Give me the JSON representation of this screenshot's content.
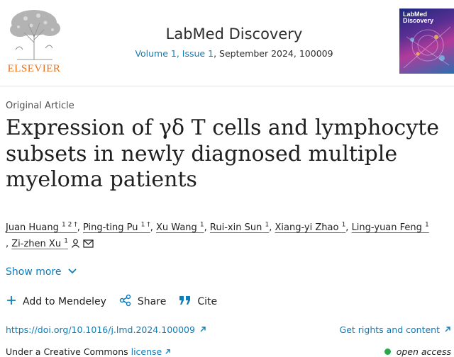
{
  "header": {
    "publisher_name": "ELSEVIER",
    "journal_title": "LabMed Discovery",
    "volume_issue": "Volume 1, Issue 1",
    "date_id": ", September 2024, 100009",
    "cover_title_line1": "LabMed",
    "cover_title_line2": "Discovery"
  },
  "article": {
    "type": "Original Article",
    "title": "Expression of γδ T cells and lymphocyte subsets in newly diagnosed multiple myeloma patients",
    "authors": [
      {
        "name": "Juan Huang",
        "sup": "1 2 †"
      },
      {
        "name": "Ping-ting Pu",
        "sup": "1 †"
      },
      {
        "name": "Xu Wang",
        "sup": "1"
      },
      {
        "name": "Rui-xin Sun",
        "sup": "1"
      },
      {
        "name": "Xiang-yi Zhao",
        "sup": "1"
      },
      {
        "name": "Ling-yuan Feng",
        "sup": "1"
      },
      {
        "name": "Zi-zhen Xu",
        "sup": "1"
      }
    ],
    "separator": ", ",
    "show_more": "Show more"
  },
  "actions": {
    "mendeley": "Add to Mendeley",
    "share": "Share",
    "cite": "Cite"
  },
  "links": {
    "doi": "https://doi.org/10.1016/j.lmd.2024.100009",
    "rights": "Get rights and content"
  },
  "license": {
    "prefix": "Under a Creative Commons ",
    "link": "license",
    "open_access": "open access"
  },
  "colors": {
    "link": "#0c7dbb",
    "elsevier_orange": "#e9711c",
    "open_access_dot": "#29a84a"
  },
  "icons": {
    "mendeley": "plus-icon",
    "share": "share-icon",
    "cite": "quote-icon",
    "external": "external-arrow-icon",
    "person": "person-icon",
    "email": "envelope-icon",
    "show_more": "chevron-down-icon"
  }
}
